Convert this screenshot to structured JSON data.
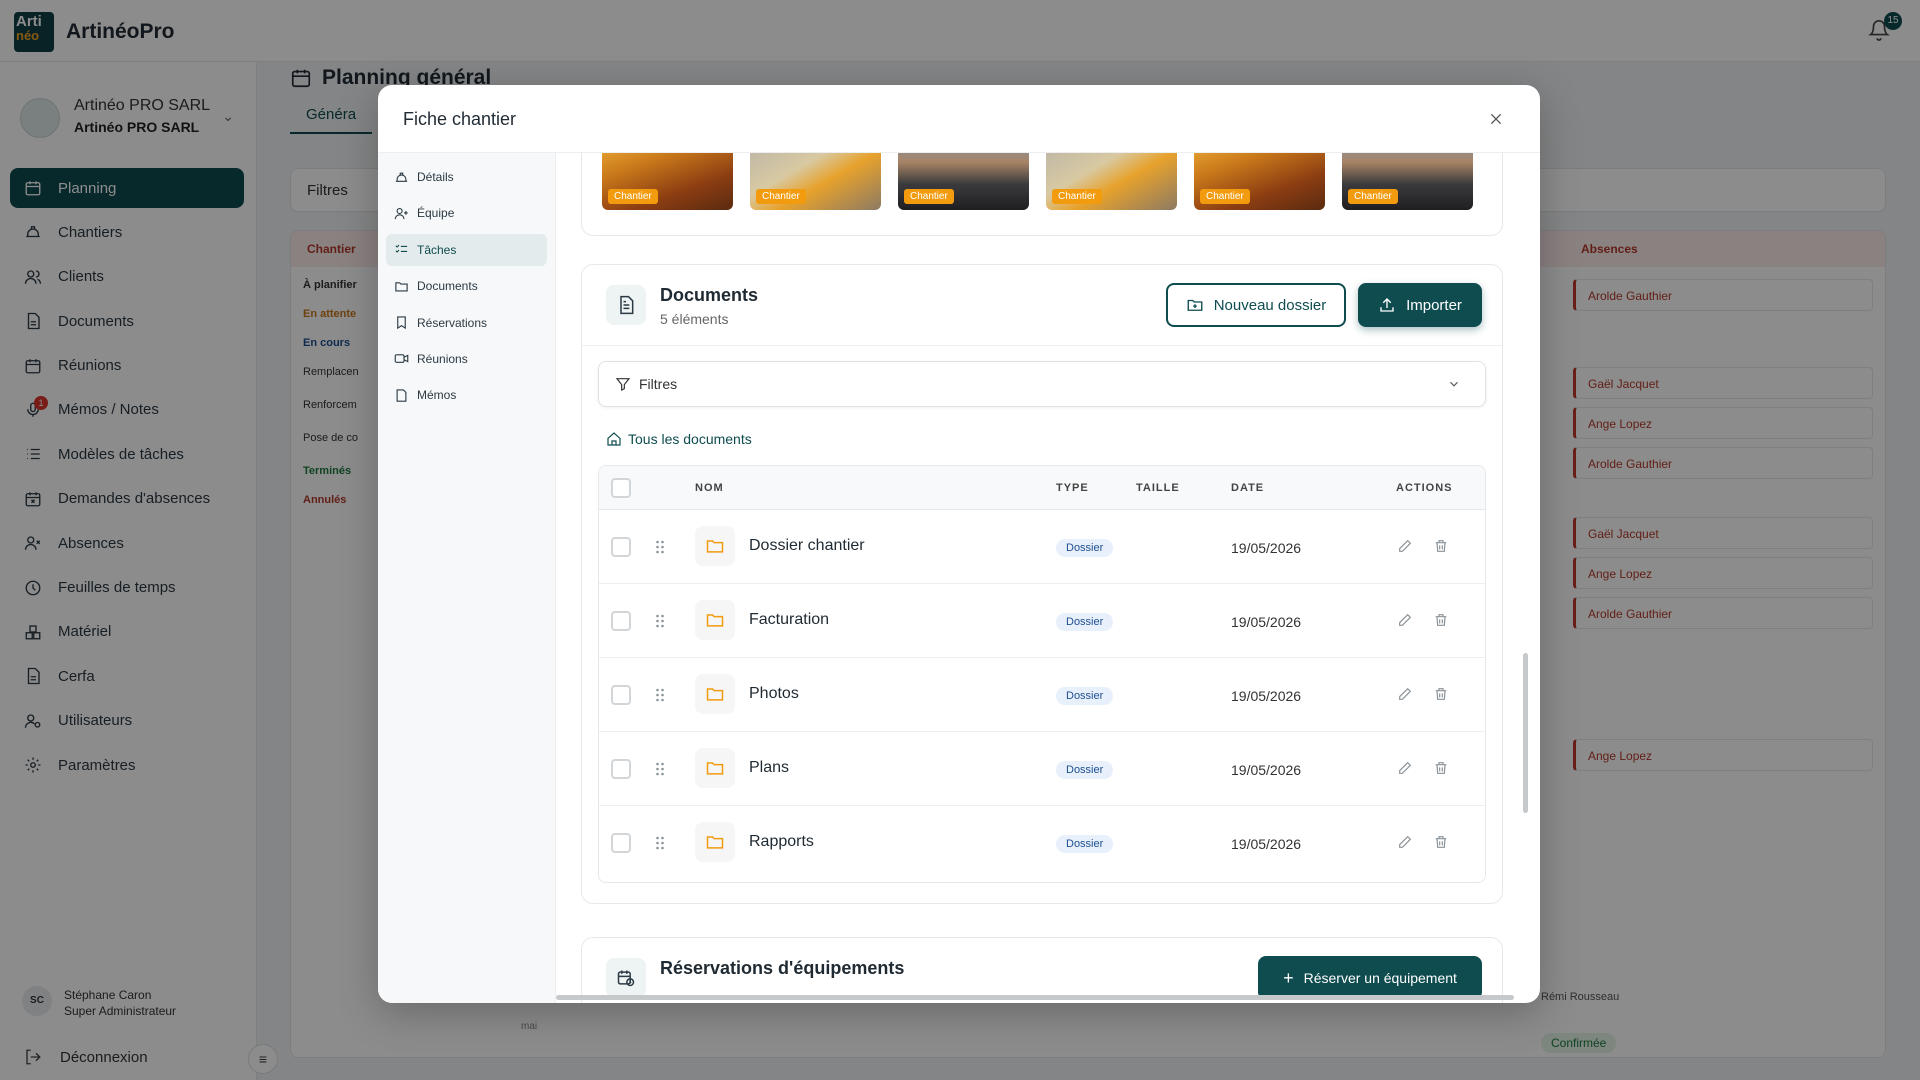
{
  "app": {
    "logo_top": "Arti",
    "logo_bottom": "néo",
    "name": "ArtinéoPro",
    "notification_count": "15"
  },
  "org": {
    "name": "Artinéo PRO SARL",
    "subname": "Artinéo PRO SARL"
  },
  "sidebar": {
    "items": [
      {
        "label": "Planning",
        "icon": "calendar-icon"
      },
      {
        "label": "Chantiers",
        "icon": "hard-hat-icon"
      },
      {
        "label": "Clients",
        "icon": "users-icon"
      },
      {
        "label": "Documents",
        "icon": "file-icon"
      },
      {
        "label": "Réunions",
        "icon": "calendar-icon"
      },
      {
        "label": "Mémos / Notes",
        "icon": "mic-icon",
        "badge": "1"
      },
      {
        "label": "Modèles de tâches",
        "icon": "list-icon"
      },
      {
        "label": "Demandes d'absences",
        "icon": "calendar-x-icon"
      },
      {
        "label": "Absences",
        "icon": "user-x-icon"
      },
      {
        "label": "Feuilles de temps",
        "icon": "clock-icon"
      },
      {
        "label": "Matériel",
        "icon": "boxes-icon"
      },
      {
        "label": "Cerfa",
        "icon": "file-icon"
      },
      {
        "label": "Utilisateurs",
        "icon": "user-cog-icon"
      },
      {
        "label": "Paramètres",
        "icon": "gear-icon"
      }
    ],
    "user": {
      "initials": "SC",
      "name": "Stéphane Caron",
      "role": "Super Administrateur"
    },
    "logout": "Déconnexion"
  },
  "background": {
    "title": "Planning général",
    "tab": "Généra",
    "filters": "Filtres",
    "col_left": "Chantier",
    "col_right": "Absences",
    "groups": [
      {
        "label": "À planifier",
        "kind": "group"
      },
      {
        "label": "En attente",
        "kind": "group"
      },
      {
        "label": "En cours",
        "kind": "group"
      },
      {
        "label": "Remplacen",
        "kind": "item"
      },
      {
        "label": "Renforcem",
        "kind": "item"
      },
      {
        "label": "Pose de co",
        "kind": "item"
      },
      {
        "label": "Terminés",
        "kind": "group"
      },
      {
        "label": "Annulés",
        "kind": "group"
      }
    ],
    "absences": [
      "Arolde Gauthier",
      "Gaël Jacquet",
      "Ange Lopez",
      "Arolde Gauthier",
      "Gaël Jacquet",
      "Ange Lopez",
      "Arolde Gauthier",
      "Ange Lopez"
    ],
    "footer_name": "Rémi Rousseau",
    "footer_status": "Confirmée",
    "day_label": "mai"
  },
  "modal": {
    "title": "Fiche chantier",
    "nav": [
      {
        "label": "Détails",
        "icon": "hard-hat-icon"
      },
      {
        "label": "Équipe",
        "icon": "user-plus-icon"
      },
      {
        "label": "Tâches",
        "icon": "list-checks-icon",
        "active": true
      },
      {
        "label": "Documents",
        "icon": "folder-icon"
      },
      {
        "label": "Réservations",
        "icon": "bookmark-icon"
      },
      {
        "label": "Réunions",
        "icon": "video-icon"
      },
      {
        "label": "Mémos",
        "icon": "note-icon"
      }
    ],
    "photos": [
      "Chantier",
      "Chantier",
      "Chantier",
      "Chantier",
      "Chantier",
      "Chantier"
    ],
    "documents": {
      "title": "Documents",
      "count": "5 éléments",
      "new_folder": "Nouveau dossier",
      "import": "Importer",
      "filters": "Filtres",
      "breadcrumb": "Tous les documents",
      "columns": {
        "name": "NOM",
        "type": "TYPE",
        "size": "TAILLE",
        "date": "DATE",
        "actions": "ACTIONS"
      },
      "rows": [
        {
          "name": "Dossier chantier",
          "type": "Dossier",
          "size": "",
          "date": "19/05/2026"
        },
        {
          "name": "Facturation",
          "type": "Dossier",
          "size": "",
          "date": "19/05/2026"
        },
        {
          "name": "Photos",
          "type": "Dossier",
          "size": "",
          "date": "19/05/2026"
        },
        {
          "name": "Plans",
          "type": "Dossier",
          "size": "",
          "date": "19/05/2026"
        },
        {
          "name": "Rapports",
          "type": "Dossier",
          "size": "",
          "date": "19/05/2026"
        }
      ]
    },
    "reservations": {
      "title": "Réservations d'équipements",
      "button": "Réserver un équipement"
    }
  },
  "colors": {
    "primary": "#0f4c4f",
    "accent": "#f29b0f",
    "danger": "#c0392b"
  }
}
